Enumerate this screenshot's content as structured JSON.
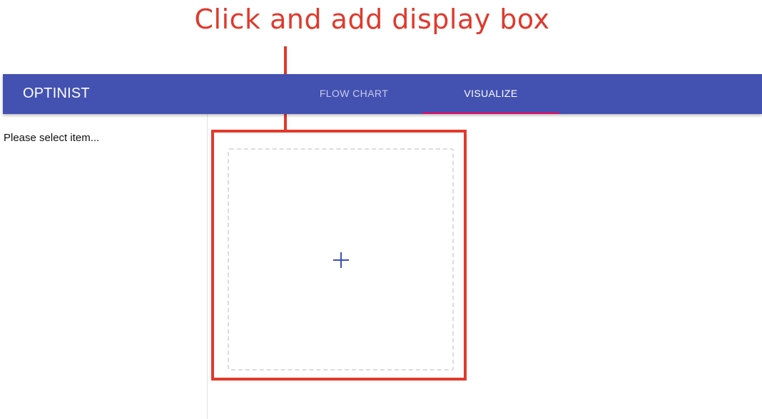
{
  "annotation": {
    "text": "Click and add display box",
    "color": "#e0392c"
  },
  "app_bar": {
    "title": "OPTINIST",
    "background": "#4351b1",
    "tabs": [
      {
        "label": "FLOW CHART",
        "selected": false
      },
      {
        "label": "VISUALIZE",
        "selected": true
      }
    ],
    "indicator_color": "#f50057"
  },
  "side_panel": {
    "message": "Please select item..."
  },
  "add_display_box": {
    "icon": "plus-icon",
    "icon_color": "#3f4db4"
  }
}
